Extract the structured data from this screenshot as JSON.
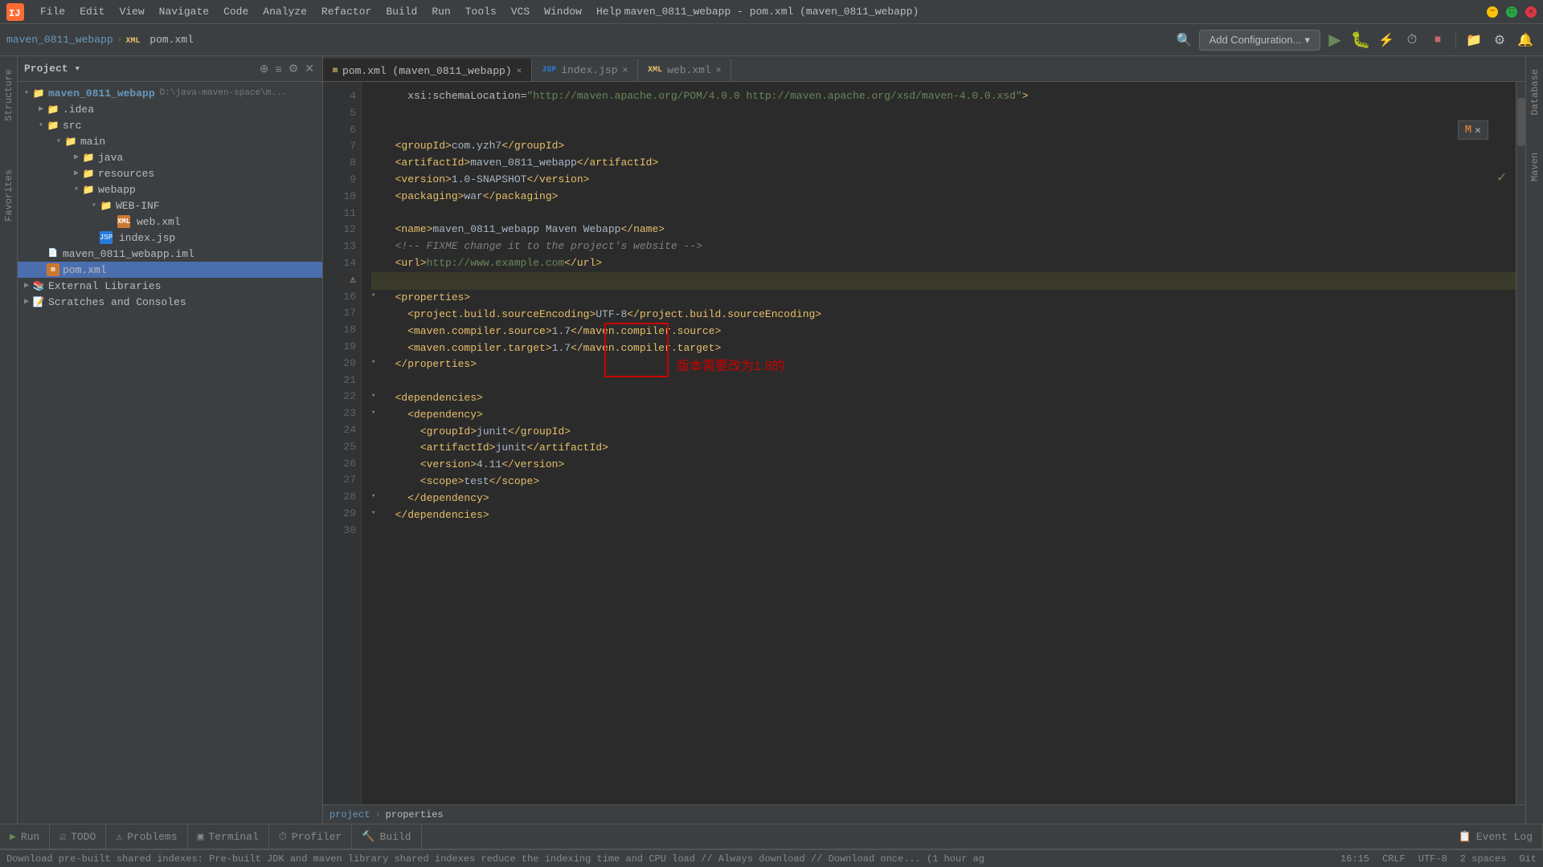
{
  "titlebar": {
    "title": "maven_0811_webapp - pom.xml (maven_0811_webapp)",
    "controls": {
      "minimize": "─",
      "maximize": "□",
      "close": "✕"
    }
  },
  "menus": [
    "File",
    "Edit",
    "View",
    "Navigate",
    "Code",
    "Analyze",
    "Refactor",
    "Build",
    "Run",
    "Tools",
    "VCS",
    "Window",
    "Help"
  ],
  "toolbar": {
    "project_name": "maven_0811_webapp",
    "file_name": "pom.xml",
    "add_config_label": "Add Configuration..."
  },
  "project_panel": {
    "title": "Project",
    "root": "maven_0811_webapp",
    "root_path": "D:\\java-maven-space\\m...",
    "items": [
      {
        "label": ".idea",
        "type": "folder",
        "indent": 1
      },
      {
        "label": "src",
        "type": "folder",
        "indent": 1
      },
      {
        "label": "main",
        "type": "folder",
        "indent": 2
      },
      {
        "label": "java",
        "type": "folder",
        "indent": 3
      },
      {
        "label": "resources",
        "type": "folder",
        "indent": 3
      },
      {
        "label": "webapp",
        "type": "folder",
        "indent": 3
      },
      {
        "label": "WEB-INF",
        "type": "folder",
        "indent": 4
      },
      {
        "label": "web.xml",
        "type": "xml",
        "indent": 5
      },
      {
        "label": "index.jsp",
        "type": "jsp",
        "indent": 4
      },
      {
        "label": "maven_0811_webapp.iml",
        "type": "iml",
        "indent": 1
      },
      {
        "label": "pom.xml",
        "type": "pom",
        "indent": 1,
        "selected": true
      },
      {
        "label": "External Libraries",
        "type": "lib",
        "indent": 0
      },
      {
        "label": "Scratches and Consoles",
        "type": "scratches",
        "indent": 0
      }
    ]
  },
  "tabs": [
    {
      "label": "pom.xml (maven_0811_webapp)",
      "type": "xml",
      "active": true
    },
    {
      "label": "index.jsp",
      "type": "jsp",
      "active": false
    },
    {
      "label": "web.xml",
      "type": "xml",
      "active": false
    }
  ],
  "code_lines": [
    {
      "num": 4,
      "content": "    xsi:schemaLocation=\"http://maven.apache.org/POM/4.0.0 http://maven.apache.org/xsd/maven-4.0.0.xsd\">",
      "type": "attr"
    },
    {
      "num": 5,
      "content": ""
    },
    {
      "num": 6,
      "content": ""
    },
    {
      "num": 7,
      "content": "  <groupId>com.yzh7</groupId>",
      "type": "tag"
    },
    {
      "num": 8,
      "content": "  <artifactId>maven_0811_webapp</artifactId>",
      "type": "tag"
    },
    {
      "num": 9,
      "content": "  <version>1.0-SNAPSHOT</version>",
      "type": "tag"
    },
    {
      "num": 10,
      "content": "  <packaging>war</packaging>",
      "type": "tag"
    },
    {
      "num": 11,
      "content": ""
    },
    {
      "num": 12,
      "content": "  <name>maven_0811_webapp Maven Webapp</name>",
      "type": "tag"
    },
    {
      "num": 13,
      "content": "  <!-- FIXME change it to the project's website -->",
      "type": "comment"
    },
    {
      "num": 14,
      "content": "  <url>http://www.example.com</url>",
      "type": "tag"
    },
    {
      "num": 15,
      "content": "",
      "type": "warn"
    },
    {
      "num": 16,
      "content": "  <properties>",
      "type": "fold"
    },
    {
      "num": 17,
      "content": "    <project.build.sourceEncoding>UTF-8</project.build.sourceEncoding>",
      "type": "tag"
    },
    {
      "num": 18,
      "content": "    <maven.compiler.source>1.7</maven.compiler.source>",
      "type": "tag"
    },
    {
      "num": 19,
      "content": "    <maven.compiler.target>1.7</maven.compiler.target>",
      "type": "tag"
    },
    {
      "num": 20,
      "content": "  </properties>",
      "type": "fold"
    },
    {
      "num": 21,
      "content": ""
    },
    {
      "num": 22,
      "content": "  <dependencies>",
      "type": "fold"
    },
    {
      "num": 23,
      "content": "    <dependency>",
      "type": "fold"
    },
    {
      "num": 24,
      "content": "      <groupId>junit</groupId>",
      "type": "tag"
    },
    {
      "num": 25,
      "content": "      <artifactId>junit</artifactId>",
      "type": "tag"
    },
    {
      "num": 26,
      "content": "      <version>4.11</version>",
      "type": "tag"
    },
    {
      "num": 27,
      "content": "      <scope>test</scope>",
      "type": "tag"
    },
    {
      "num": 28,
      "content": "    </dependency>",
      "type": "tag"
    },
    {
      "num": 29,
      "content": "  </dependencies>",
      "type": "tag"
    },
    {
      "num": 30,
      "content": ""
    }
  ],
  "annotation": {
    "text": "版本需要改为1.8的",
    "visible": true
  },
  "breadcrumb_bottom": {
    "items": [
      "project",
      "properties"
    ]
  },
  "bottom_tabs": [
    "Run",
    "TODO",
    "Problems",
    "Terminal",
    "Profiler",
    "Build"
  ],
  "status": {
    "message": "Download pre-built shared indexes: Pre-built JDK and maven library shared indexes reduce the indexing time and CPU load // Always download // Download once... (1 hour ag",
    "position": "16:15",
    "encoding": "CRLF",
    "indent": "UTF-8",
    "spaces": "2 spaces"
  },
  "right_panel_tabs": [
    "Database",
    "Maven"
  ],
  "left_panel_tabs": [
    "Structure",
    "Favorites"
  ],
  "event_log": "Event Log"
}
